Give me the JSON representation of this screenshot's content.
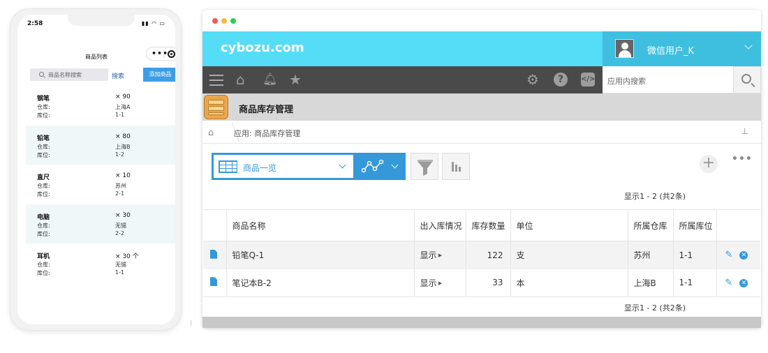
{
  "phone": {
    "status_time": "2:58",
    "title": "商品列表",
    "search_placeholder": "商品名称搜索",
    "search_button": "搜索",
    "add_button": "添加商品",
    "warehouse_label": "仓库:",
    "location_label": "库位:",
    "items": [
      {
        "name": "钢笔",
        "qty": "× 90",
        "warehouse": "上海A",
        "location": "1-1"
      },
      {
        "name": "铅笔",
        "qty": "× 80",
        "warehouse": "上海B",
        "location": "1-2"
      },
      {
        "name": "直尺",
        "qty": "× 10",
        "warehouse": "苏州",
        "location": "2-1"
      },
      {
        "name": "电脑",
        "qty": "× 30",
        "warehouse": "无锡",
        "location": "2-2"
      },
      {
        "name": "耳机",
        "qty": "× 30 个",
        "warehouse": "无锡",
        "location": "1-1"
      }
    ]
  },
  "browser": {
    "logo": "cybozu.com",
    "user_name": "微信用户_K",
    "search_placeholder": "应用内搜索",
    "app_title": "商品库存管理",
    "breadcrumb": "应用: 商品库存管理",
    "view_name": "商品一览",
    "pager_top": "显示1 - 2  (共2条)",
    "pager_bottom": "显示1 - 2  (共2条)",
    "columns": [
      "商品名称",
      "出入库情况",
      "库存数量",
      "单位",
      "所属仓库",
      "所属库位"
    ],
    "rows": [
      {
        "name": "铅笔Q-1",
        "status": "显示",
        "stock": "122",
        "unit": "支",
        "warehouse": "苏州",
        "location": "1-1"
      },
      {
        "name": "笔记本B-2",
        "status": "显示",
        "stock": "33",
        "unit": "本",
        "warehouse": "上海B",
        "location": "1-1"
      }
    ]
  },
  "colors": {
    "header": "#55dcf6",
    "accent": "#3498db",
    "toolbar": "#4a4a4a"
  }
}
